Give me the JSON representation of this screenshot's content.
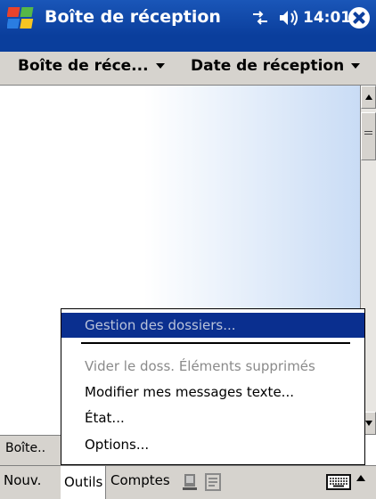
{
  "titlebar": {
    "title": "Boîte de réception",
    "clock": "14:01",
    "icons": [
      "windows-start-icon",
      "connectivity-icon",
      "volume-icon",
      "close-icon"
    ]
  },
  "header": {
    "folder_filter": "Boîte de réce...",
    "sort_by": "Date de réception"
  },
  "folders_tab": "Boîte..",
  "menu": {
    "items": [
      {
        "label": "Gestion des dossiers...",
        "state": "highlighted"
      },
      {
        "label": "Vider le doss. Éléments supprimés",
        "state": "disabled"
      },
      {
        "label": "Modifier mes messages texte...",
        "state": "enabled"
      },
      {
        "label": "État...",
        "state": "enabled"
      },
      {
        "label": "Options...",
        "state": "enabled"
      }
    ]
  },
  "bottom_bar": {
    "new": "Nouv.",
    "tools": "Outils",
    "accounts": "Comptes",
    "icons": [
      "send-receive-icon",
      "attachment-icon",
      "keyboard-icon",
      "input-panel-arrow-icon"
    ]
  },
  "colors": {
    "titlebar": "#0a3e9c",
    "menu_highlight": "#0a2f8f",
    "chrome": "#d6d3ce"
  }
}
